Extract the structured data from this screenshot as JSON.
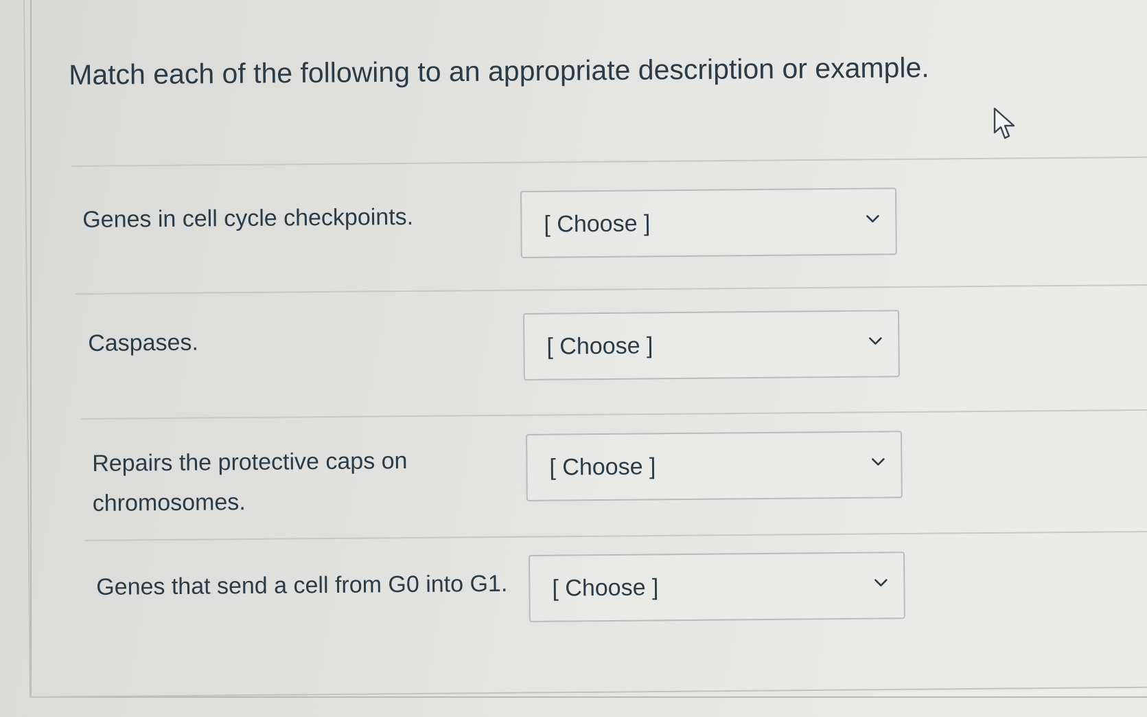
{
  "question": {
    "prompt": "Match each of the following to an appropriate description or example."
  },
  "matches": [
    {
      "label": "Genes in cell cycle checkpoints.",
      "selected": "[ Choose ]"
    },
    {
      "label": "Caspases.",
      "selected": "[ Choose ]"
    },
    {
      "label_line1": "Repairs the protective caps on",
      "label_line2": "chromosomes.",
      "selected": "[ Choose ]"
    },
    {
      "label": "Genes that send a cell from G0 into G1.",
      "selected": "[ Choose ]"
    }
  ],
  "icons": {
    "dropdown": "chevron-down-icon",
    "pointer": "mouse-cursor-icon"
  },
  "colors": {
    "text": "#2d3b45",
    "border": "#b8bcbf",
    "divider": "#c8c8c6"
  }
}
